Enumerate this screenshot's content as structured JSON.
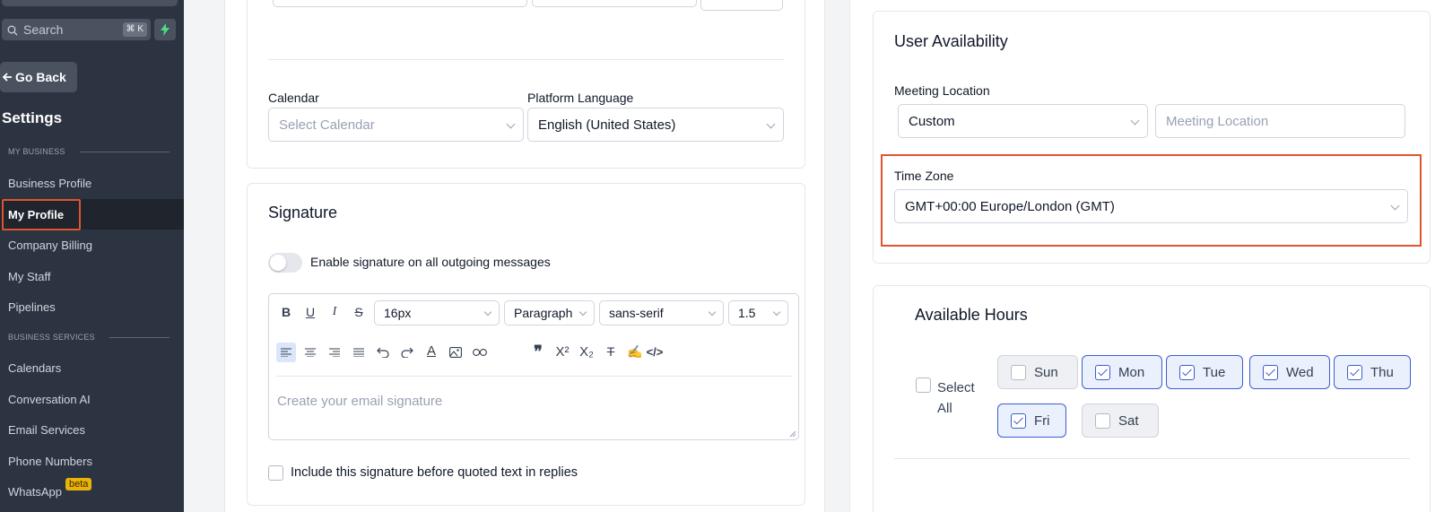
{
  "sidebar": {
    "search_placeholder": "Search",
    "search_shortcut": "⌘ K",
    "go_back": "Go Back",
    "title": "Settings",
    "section_my_business": "MY BUSINESS",
    "section_business_services": "BUSINESS SERVICES",
    "items": [
      {
        "label": "Business Profile"
      },
      {
        "label": "My Profile",
        "active": true
      },
      {
        "label": "Company Billing"
      },
      {
        "label": "My Staff"
      },
      {
        "label": "Pipelines"
      },
      {
        "label": "Calendars"
      },
      {
        "label": "Conversation AI"
      },
      {
        "label": "Email Services"
      },
      {
        "label": "Phone Numbers"
      },
      {
        "label": "WhatsApp",
        "badge": "beta"
      }
    ]
  },
  "profile": {
    "calendar_label": "Calendar",
    "calendar_placeholder": "Select Calendar",
    "language_label": "Platform Language",
    "language_value": "English (United States)"
  },
  "signature": {
    "title": "Signature",
    "enable_label": "Enable signature on all outgoing messages",
    "font_size": "16px",
    "block_type": "Paragraph",
    "font_family": "sans-serif",
    "line_height": "1.5",
    "editor_placeholder": "Create your email signature",
    "include_label": "Include this signature before quoted text in replies"
  },
  "availability": {
    "title": "User Availability",
    "meeting_location_label": "Meeting Location",
    "meeting_type": "Custom",
    "meeting_location_placeholder": "Meeting Location",
    "timezone_label": "Time Zone",
    "timezone_value": "GMT+00:00 Europe/London (GMT)"
  },
  "hours": {
    "title": "Available Hours",
    "select_all_line1": "Select",
    "select_all_line2": "All",
    "days": [
      {
        "label": "Sun",
        "checked": false
      },
      {
        "label": "Mon",
        "checked": true
      },
      {
        "label": "Tue",
        "checked": true
      },
      {
        "label": "Wed",
        "checked": true
      },
      {
        "label": "Thu",
        "checked": true
      },
      {
        "label": "Fri",
        "checked": true
      },
      {
        "label": "Sat",
        "checked": false
      }
    ]
  },
  "colors": {
    "sidebar_bg": "#2d3441",
    "accent": "#3b5fcf",
    "highlight": "#e0542f"
  }
}
